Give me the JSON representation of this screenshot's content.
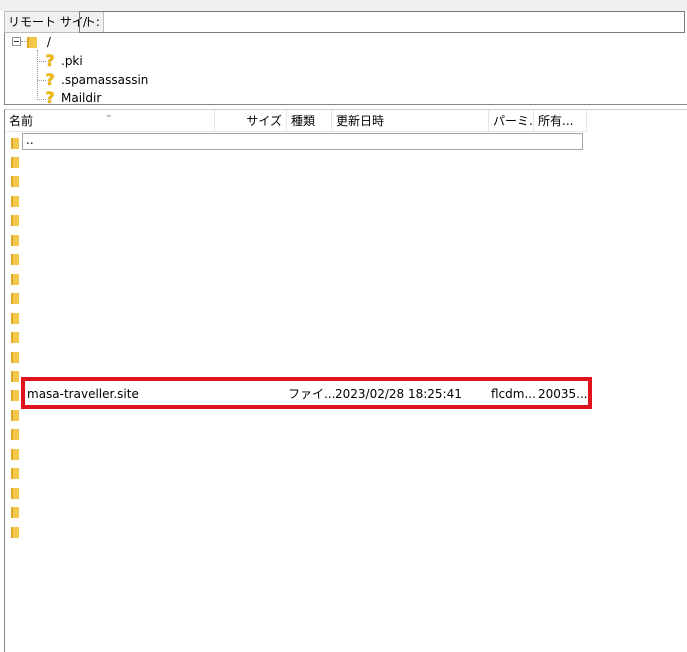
{
  "remote_site": {
    "label": "リモート サイト:",
    "path": "/"
  },
  "tree": {
    "root": "/",
    "children": [
      ".pki",
      ".spamassassin",
      "Maildir"
    ]
  },
  "file_list": {
    "columns": {
      "name": "名前",
      "size": "サイズ",
      "type": "種類",
      "modified": "更新日時",
      "permissions": "パーミ...",
      "owner": "所有..."
    },
    "parent_dir": "..",
    "selected_file": {
      "name": "masa-traveller.site",
      "type": "ファイ...",
      "modified": "2023/02/28 18:25:41",
      "permissions": "flcdm...",
      "owner": "20035..."
    }
  },
  "colors": {
    "highlight": "#e0121e",
    "folder": "#f3c84a"
  }
}
